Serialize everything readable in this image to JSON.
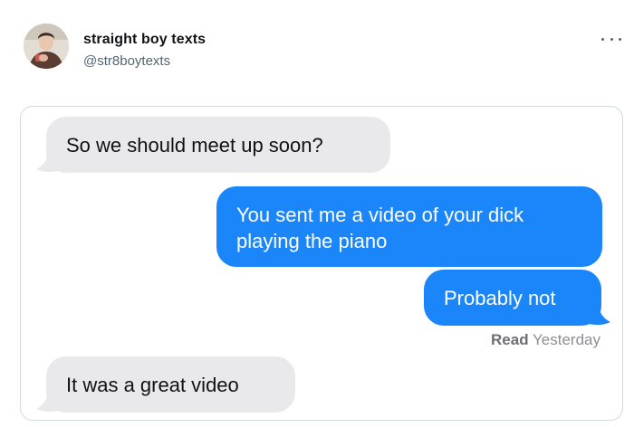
{
  "tweet": {
    "author": {
      "display_name": "straight boy texts",
      "handle": "@str8boytexts",
      "avatar_icon": "profile-photo"
    },
    "more_icon": "more-horizontal-icon"
  },
  "conversation": {
    "messages": [
      {
        "direction": "received",
        "text": "So we should meet up soon?"
      },
      {
        "direction": "sent",
        "text": "You sent me a video of your dick playing the piano"
      },
      {
        "direction": "sent",
        "text": "Probably not"
      },
      {
        "direction": "received",
        "text": "It was a great video"
      }
    ],
    "read_receipt": {
      "label": "Read",
      "time": "Yesterday"
    }
  },
  "colors": {
    "sent_bubble": "#1a86f9",
    "received_bubble": "#e9e9eb",
    "handle_text": "#536471",
    "card_border": "#cfd9de"
  }
}
